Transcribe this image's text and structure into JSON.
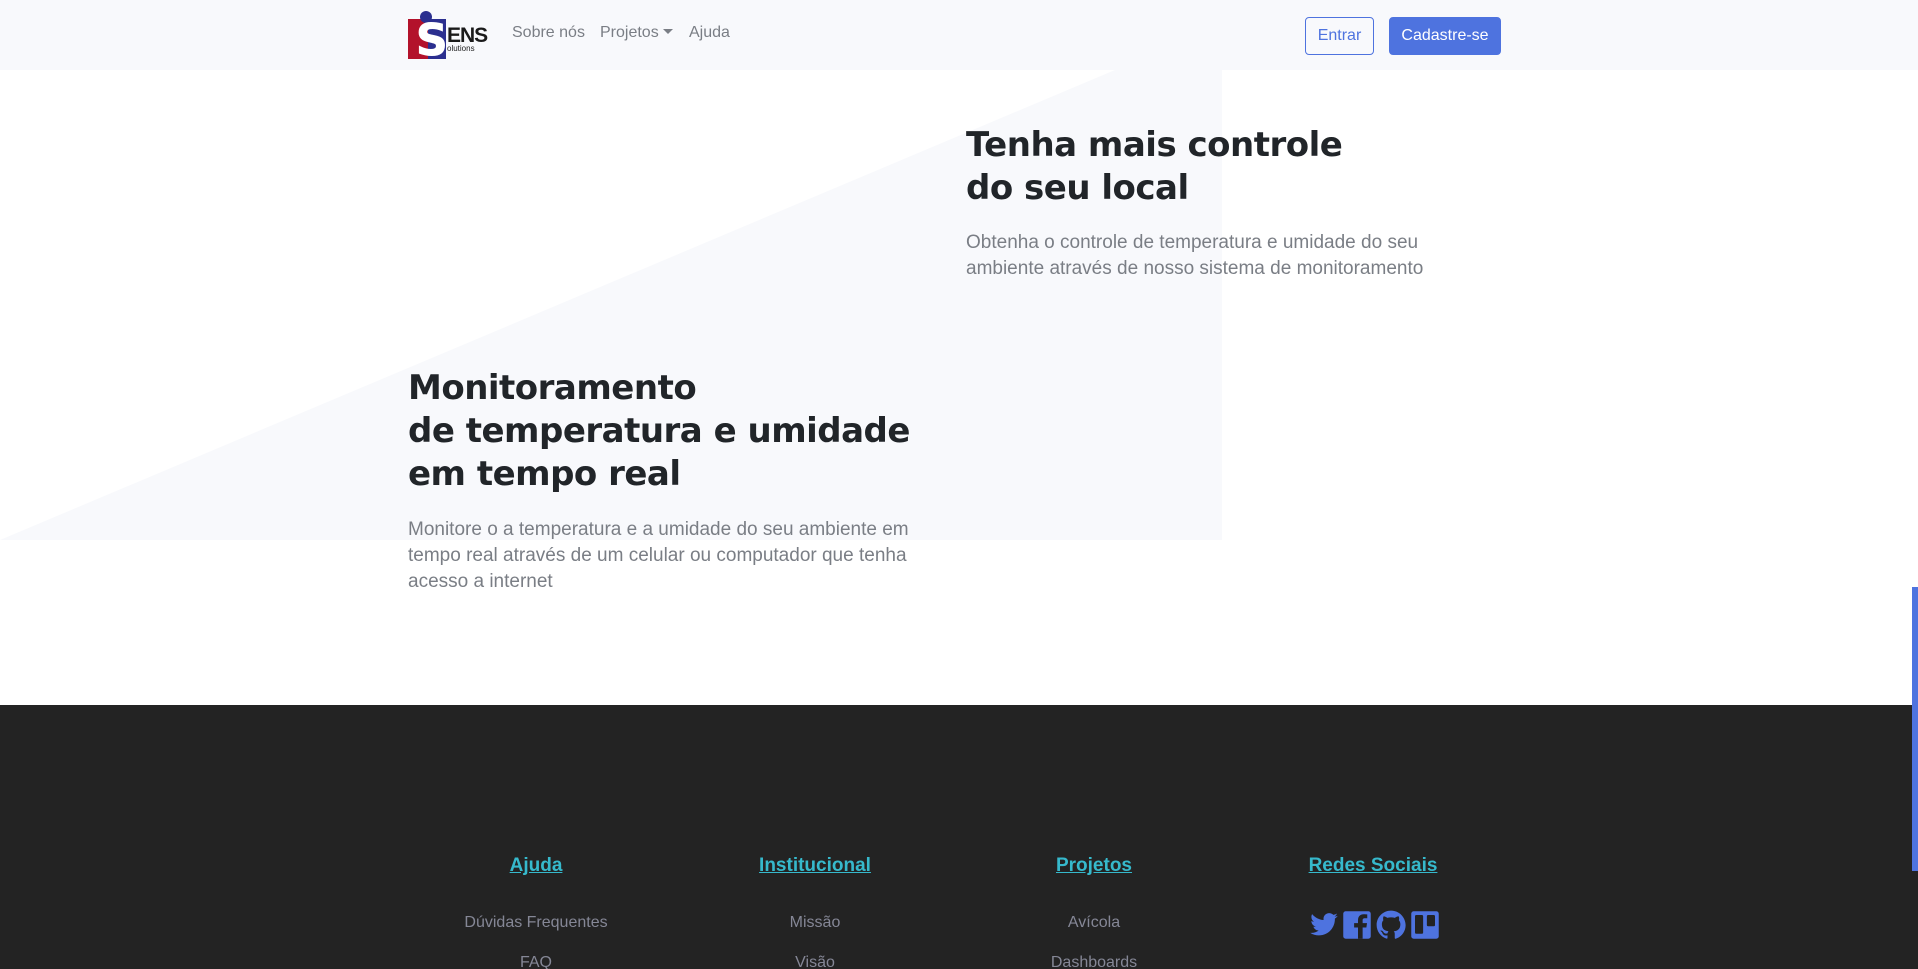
{
  "header": {
    "brand": {
      "text": "ENS",
      "subtext": "olutions"
    },
    "nav": {
      "sobre": "Sobre nós",
      "projetos": "Projetos",
      "ajuda": "Ajuda"
    },
    "buttons": {
      "entrar": "Entrar",
      "cadastro": "Cadastre-se"
    }
  },
  "colors": {
    "primary": "#4e73df",
    "footer_bg": "#232323",
    "footer_title": "#36b9cc",
    "muted_text": "#7a7e85"
  },
  "features": [
    {
      "title_lines": [
        "Tenha mais controle",
        "do seu local"
      ],
      "text": "Obtenha o controle de temperatura e umidade do seu ambiente através de nosso sistema de monitoramento"
    },
    {
      "title_lines": [
        "Monitoramento",
        "de temperatura e umidade",
        "em tempo real"
      ],
      "text": "Monitore o a temperatura e a umidade do seu ambiente em tempo real através de um celular ou computador que tenha acesso a internet"
    }
  ],
  "footer": {
    "columns": [
      {
        "title": "Ajuda",
        "links": [
          "Dúvidas Frequentes",
          "FAQ"
        ]
      },
      {
        "title": "Institucional",
        "links": [
          "Missão",
          "Visão"
        ]
      },
      {
        "title": "Projetos",
        "links": [
          "Avícola",
          "Dashboards"
        ]
      },
      {
        "title": "Redes Sociais",
        "icons": [
          "twitter-icon",
          "facebook-icon",
          "github-icon",
          "trello-icon"
        ]
      }
    ]
  }
}
